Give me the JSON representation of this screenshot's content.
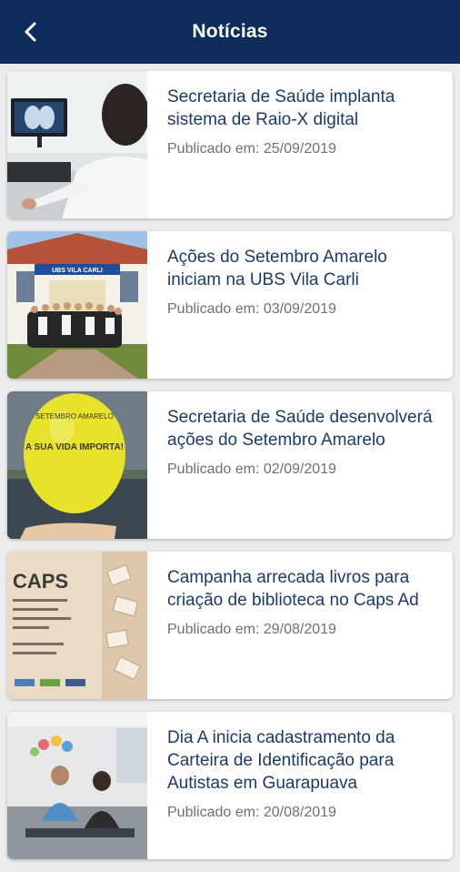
{
  "header": {
    "title": "Notícias",
    "back_icon": "chevron-left-icon",
    "background": "#0f2d5c"
  },
  "news": [
    {
      "title": "Secretaria de Saúde implanta sistema de Raio-X digital",
      "date": "Publicado em: 25/09/2019",
      "thumb": "x-ray-monitor-photo"
    },
    {
      "title": "Ações do Setembro Amarelo iniciam na UBS Vila Carli",
      "date": "Publicado em: 03/09/2019",
      "thumb": "group-photo-ubs",
      "image_text": "UBS VILA CARLI"
    },
    {
      "title": "Secretaria de Saúde desenvolverá ações do Setembro Amarelo",
      "date": "Publicado em: 02/09/2019",
      "thumb": "yellow-balloon-photo",
      "image_text": "SETEMBRO AMARELO\nA SUA VIDA IMPORTA!"
    },
    {
      "title": "Campanha arrecada livros para criação de biblioteca no Caps Ad",
      "date": "Publicado em: 29/08/2019",
      "thumb": "caps-flyer",
      "image_text": "CAPS"
    },
    {
      "title": "Dia A inicia cadastramento da Carteira de Identificação para Autistas em Guarapuava",
      "date": "Publicado em: 20/08/2019",
      "thumb": "waiting-room-photo"
    }
  ]
}
